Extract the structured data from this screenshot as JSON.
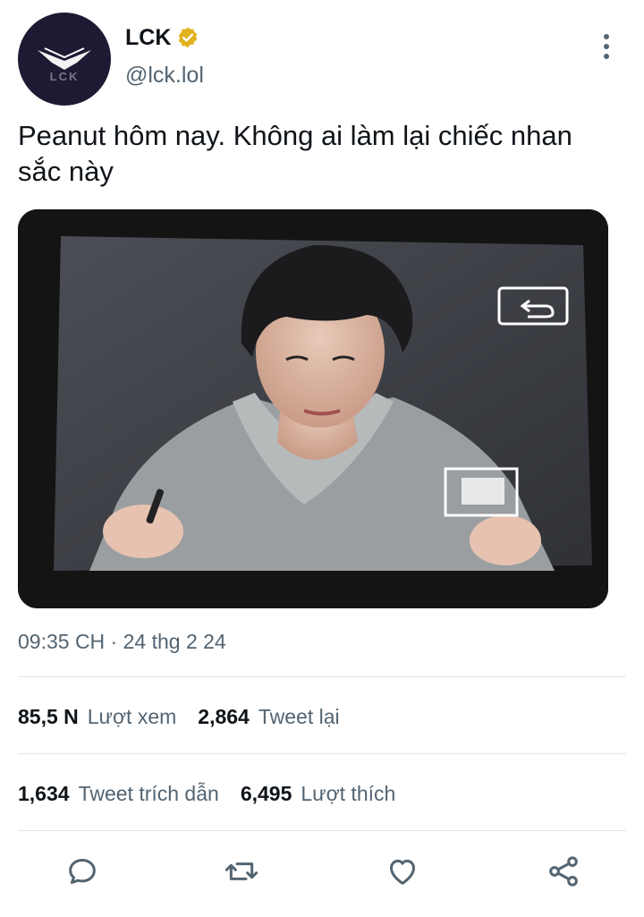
{
  "tweet": {
    "display_name": "LCK",
    "handle": "@lck.lol",
    "text": "Peanut hôm nay. Không ai làm lại chiếc nhan sắc này",
    "timestamp": "09:35 CH · 24 thg 2 24",
    "avatar_text": "LCK"
  },
  "stats": {
    "views": {
      "value": "85,5 N",
      "label": "Lượt xem"
    },
    "retweets": {
      "value": "2,864",
      "label": "Tweet lại"
    },
    "quotes": {
      "value": "1,634",
      "label": "Tweet trích dẫn"
    },
    "likes": {
      "value": "6,495",
      "label": "Lượt thích"
    }
  },
  "icons": {
    "verified": "verified-badge-icon",
    "more": "more-vertical-icon",
    "reply": "reply-icon",
    "retweet": "retweet-icon",
    "like": "heart-icon",
    "share": "share-icon"
  },
  "colors": {
    "text": "#0f1419",
    "muted": "#536471",
    "verified": "#e2b21f",
    "avatar_bg": "#1f1a33"
  }
}
